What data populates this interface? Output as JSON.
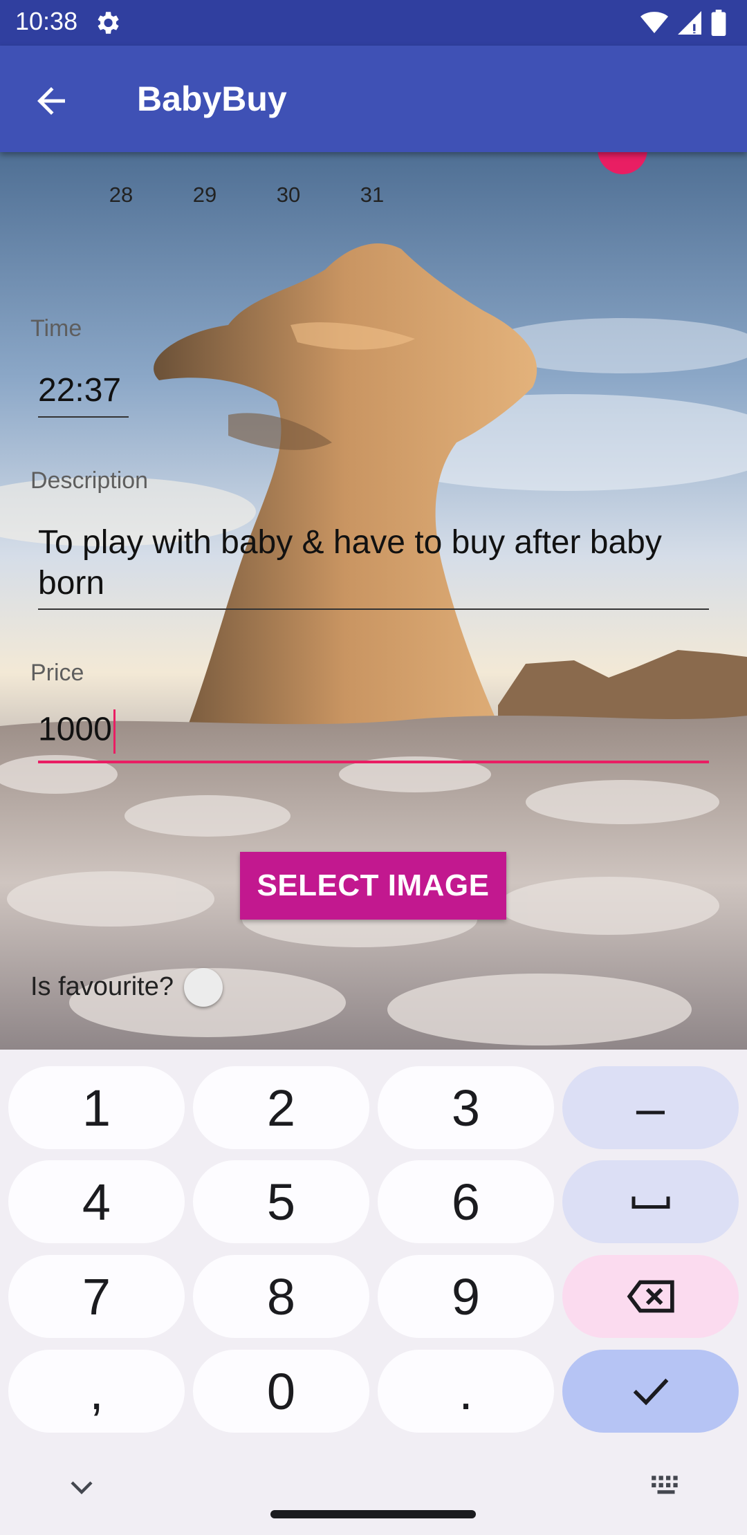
{
  "status_bar": {
    "time": "10:38"
  },
  "app_bar": {
    "title": "BabyBuy"
  },
  "calendar": {
    "days": [
      "28",
      "29",
      "30",
      "31"
    ]
  },
  "form": {
    "time_label": "Time",
    "time_value": "22:37",
    "description_label": "Description",
    "description_line1": "To play with baby & have to buy after baby",
    "description_line2": "born",
    "price_label": "Price",
    "price_value": "1000",
    "select_image_label": "SELECT IMAGE",
    "favourite_label": "Is favourite?",
    "favourite_checked": false
  },
  "keyboard": {
    "keys": [
      "1",
      "2",
      "3",
      "–",
      "4",
      "5",
      "6",
      "␣",
      "7",
      "8",
      "9",
      "⌫",
      ",",
      "0",
      ".",
      "✓"
    ]
  },
  "colors": {
    "status_bar": "#303f9f",
    "app_bar": "#3f51b5",
    "accent": "#e91e63",
    "button": "#c2188f"
  }
}
